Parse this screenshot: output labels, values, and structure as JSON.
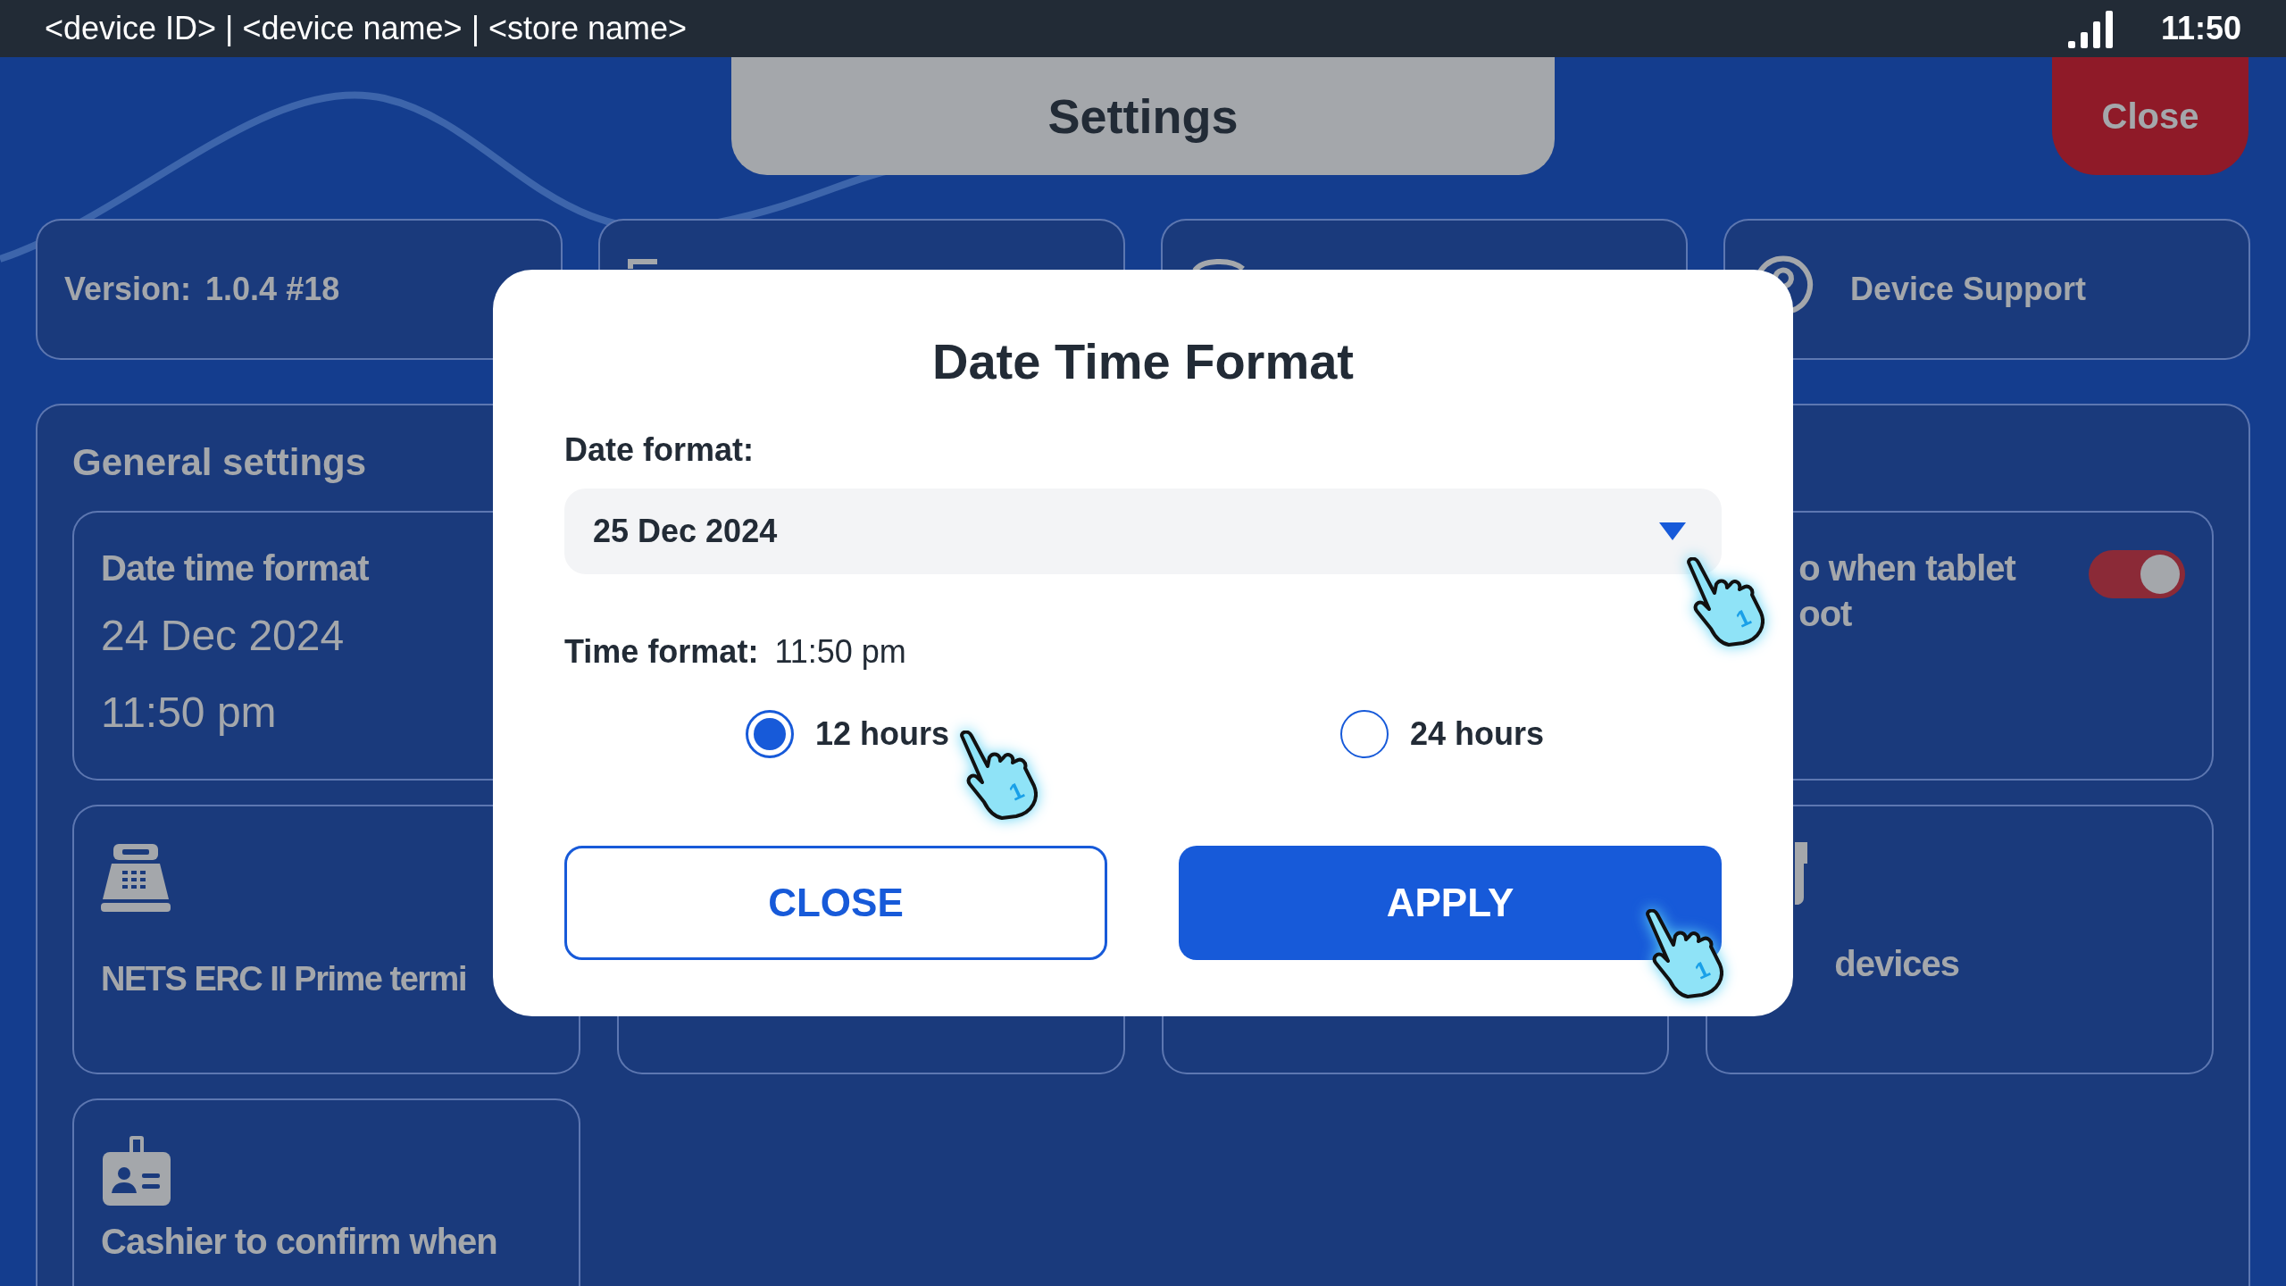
{
  "status_bar": {
    "device_info": "<device ID> | <device name> | <store name>",
    "time": "11:50"
  },
  "header": {
    "title": "Settings",
    "close_button": "Close"
  },
  "info_cards": [
    {
      "kind": "version",
      "label": "Version:",
      "value": "1.0.4 #18"
    },
    {
      "kind": "document"
    },
    {
      "kind": "sync"
    },
    {
      "kind": "support",
      "label": "Device Support"
    }
  ],
  "general_settings": {
    "title": "General settings",
    "cards": [
      {
        "kind": "datetime",
        "title": "Date time format",
        "lines": [
          "24 Dec 2024",
          "11:50 pm"
        ]
      },
      {
        "kind": "toggle",
        "lines": [
          "o when tablet",
          "oot"
        ],
        "on": true
      },
      {
        "kind": "terminal",
        "title": "NETS ERC II Prime termi"
      },
      {
        "kind": "covered"
      },
      {
        "kind": "covered"
      },
      {
        "kind": "devices",
        "title": "devices"
      },
      {
        "kind": "cashier",
        "title": "Cashier to confirm when"
      }
    ]
  },
  "dialog": {
    "title": "Date Time Format",
    "date_label": "Date format:",
    "date_value": "25 Dec 2024",
    "time_label": "Time format:",
    "time_value": "11:50 pm",
    "options": [
      {
        "label": "12 hours",
        "selected": true
      },
      {
        "label": "24 hours",
        "selected": false
      }
    ],
    "buttons": [
      {
        "kind": "secondary",
        "label": "CLOSE"
      },
      {
        "kind": "primary",
        "label": "APPLY"
      }
    ]
  },
  "tap_markers": [
    {
      "label": "1"
    },
    {
      "label": "1"
    },
    {
      "label": "1"
    }
  ]
}
